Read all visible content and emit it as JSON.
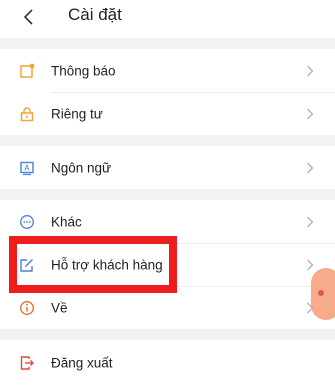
{
  "header": {
    "title": "Cài đặt"
  },
  "groups": [
    {
      "items": [
        {
          "label": "Thông báo",
          "icon": "notification-icon"
        },
        {
          "label": "Riêng tư",
          "icon": "lock-icon"
        }
      ]
    },
    {
      "items": [
        {
          "label": "Ngôn ngữ",
          "icon": "language-icon"
        }
      ]
    },
    {
      "items": [
        {
          "label": "Khác",
          "icon": "more-icon"
        },
        {
          "label": "Hỗ trợ khách hàng",
          "icon": "edit-support-icon"
        },
        {
          "label": "Về",
          "icon": "info-icon"
        }
      ]
    },
    {
      "items": [
        {
          "label": "Đăng xuất",
          "icon": "logout-icon"
        }
      ]
    }
  ],
  "colors": {
    "accent_orange": "#f0a532",
    "icon_blue": "#4a7fd6",
    "highlight_red": "#ee1c1c"
  }
}
